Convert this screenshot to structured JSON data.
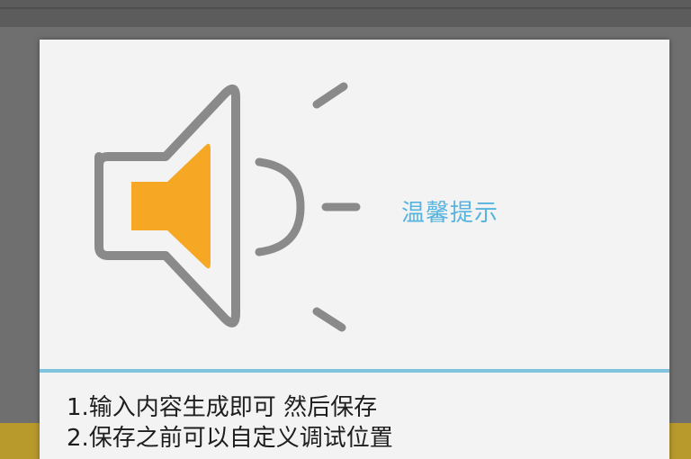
{
  "dialog": {
    "title": "温馨提示",
    "icon": "speaker-volume-icon",
    "accent_color": "#56b4de",
    "speaker_fill_color": "#f6a824",
    "speaker_outline_color": "#8a8a8a",
    "lines": [
      "1.输入内容生成即可 然后保存",
      "2.保存之前可以自定义调试位置"
    ]
  }
}
